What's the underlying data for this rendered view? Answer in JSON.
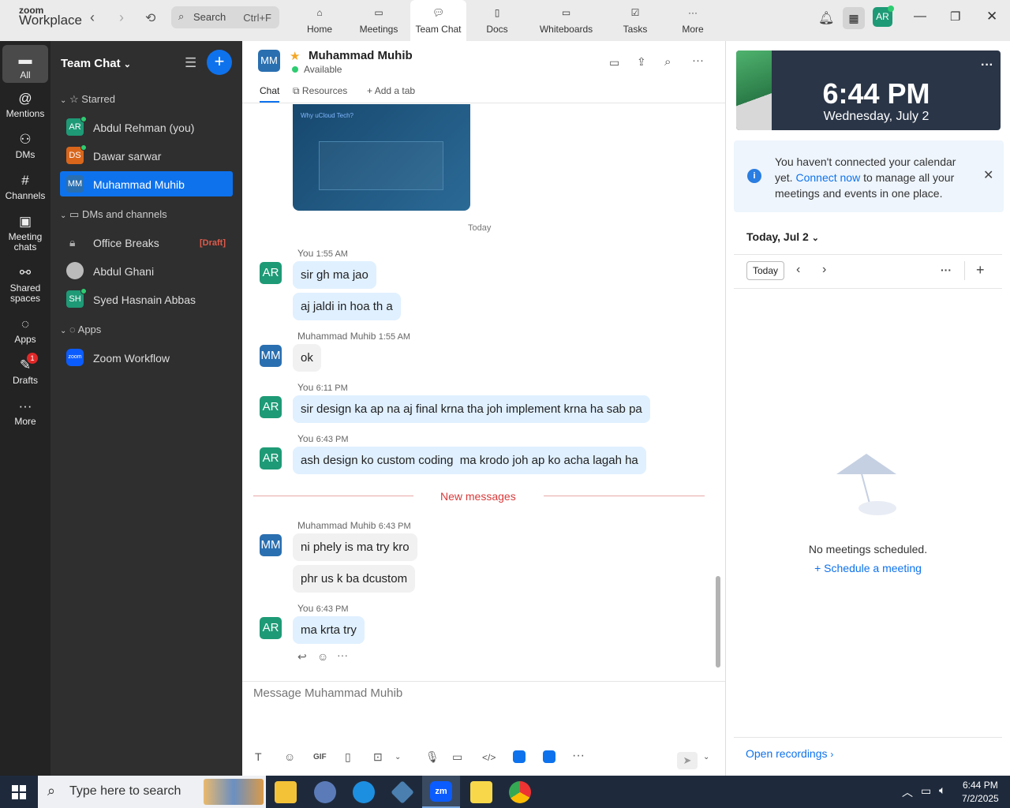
{
  "app": {
    "brand_top": "zoom",
    "brand_bottom": "Workplace"
  },
  "search": {
    "label": "Search",
    "shortcut": "Ctrl+F"
  },
  "tabs": [
    {
      "label": "Home"
    },
    {
      "label": "Meetings"
    },
    {
      "label": "Team Chat"
    },
    {
      "label": "Docs"
    },
    {
      "label": "Whiteboards"
    },
    {
      "label": "Tasks"
    },
    {
      "label": "More"
    }
  ],
  "profile": {
    "initials": "AR"
  },
  "rail": [
    {
      "label": "All"
    },
    {
      "label": "Mentions"
    },
    {
      "label": "DMs"
    },
    {
      "label": "Channels"
    },
    {
      "label": "Meeting chats"
    },
    {
      "label": "Shared spaces"
    },
    {
      "label": "Apps"
    },
    {
      "label": "Drafts",
      "badge": "1"
    },
    {
      "label": "More"
    }
  ],
  "sidebar": {
    "title": "Team Chat",
    "sections": {
      "starred": "Starred",
      "dms": "DMs and channels",
      "apps": "Apps"
    },
    "starred": [
      {
        "initials": "AR",
        "name": "Abdul Rehman (you)",
        "color": "#1e9a76"
      },
      {
        "initials": "DS",
        "name": "Dawar sarwar",
        "color": "#d9661b"
      },
      {
        "initials": "MM",
        "name": "Muhammad Muhib",
        "color": "#2a6fb0"
      }
    ],
    "dms": [
      {
        "name": "Office Breaks",
        "tag": "[Draft]"
      },
      {
        "name": "Abdul Ghani"
      },
      {
        "initials": "SH",
        "name": "Syed Hasnain Abbas",
        "color": "#1e9a76"
      }
    ],
    "apps": [
      {
        "initials": "zoom",
        "name": "Zoom Workflow"
      }
    ]
  },
  "chat": {
    "contact_initials": "MM",
    "contact_name": "Muhammad Muhib",
    "status": "Available",
    "tabs": {
      "chat": "Chat",
      "resources": "Resources",
      "add": "Add a tab"
    },
    "image_preview": {
      "title": "Why uCloud Tech?"
    },
    "date_divider": "Today",
    "new_messages": "New messages",
    "groups": [
      {
        "initials": "AR",
        "sender": "You",
        "time": "1:55 AM",
        "messages": [
          "sir gh ma jao",
          "aj jaldi in hoa th a"
        ]
      },
      {
        "initials": "MM",
        "sender": "Muhammad Muhib",
        "time": "1:55 AM",
        "messages": [
          "ok"
        ]
      },
      {
        "initials": "AR",
        "sender": "You",
        "time": "6:11 PM",
        "messages": [
          "sir design ka ap na aj final krna tha joh implement krna ha sab pa"
        ]
      },
      {
        "initials": "AR",
        "sender": "You",
        "time": "6:43 PM",
        "messages": [
          "ash design ko custom coding  ma krodo joh ap ko acha lagah ha"
        ]
      },
      {
        "initials": "MM",
        "sender": "Muhammad Muhib",
        "time": "6:43 PM",
        "messages": [
          "ni phely is ma try kro",
          "phr us k ba dcustom"
        ]
      },
      {
        "initials": "AR",
        "sender": "You",
        "time": "6:43 PM",
        "messages": [
          "ma krta try"
        ]
      }
    ],
    "compose_placeholder": "Message Muhammad Muhib"
  },
  "calendar": {
    "time": "6:44 PM",
    "date": "Wednesday, July 2",
    "notice_1": "You haven't connected your calendar",
    "notice_2a": "yet.",
    "notice_link": "Connect now",
    "notice_2b": "to manage all your",
    "notice_3": "meetings and events in one place.",
    "day_label": "Today, Jul 2",
    "today_btn": "Today",
    "empty": "No meetings scheduled.",
    "schedule": "Schedule a meeting",
    "recordings": "Open recordings"
  },
  "taskbar": {
    "search": "Type here to search",
    "time": "6:44 PM",
    "date": "7/2/2025"
  }
}
